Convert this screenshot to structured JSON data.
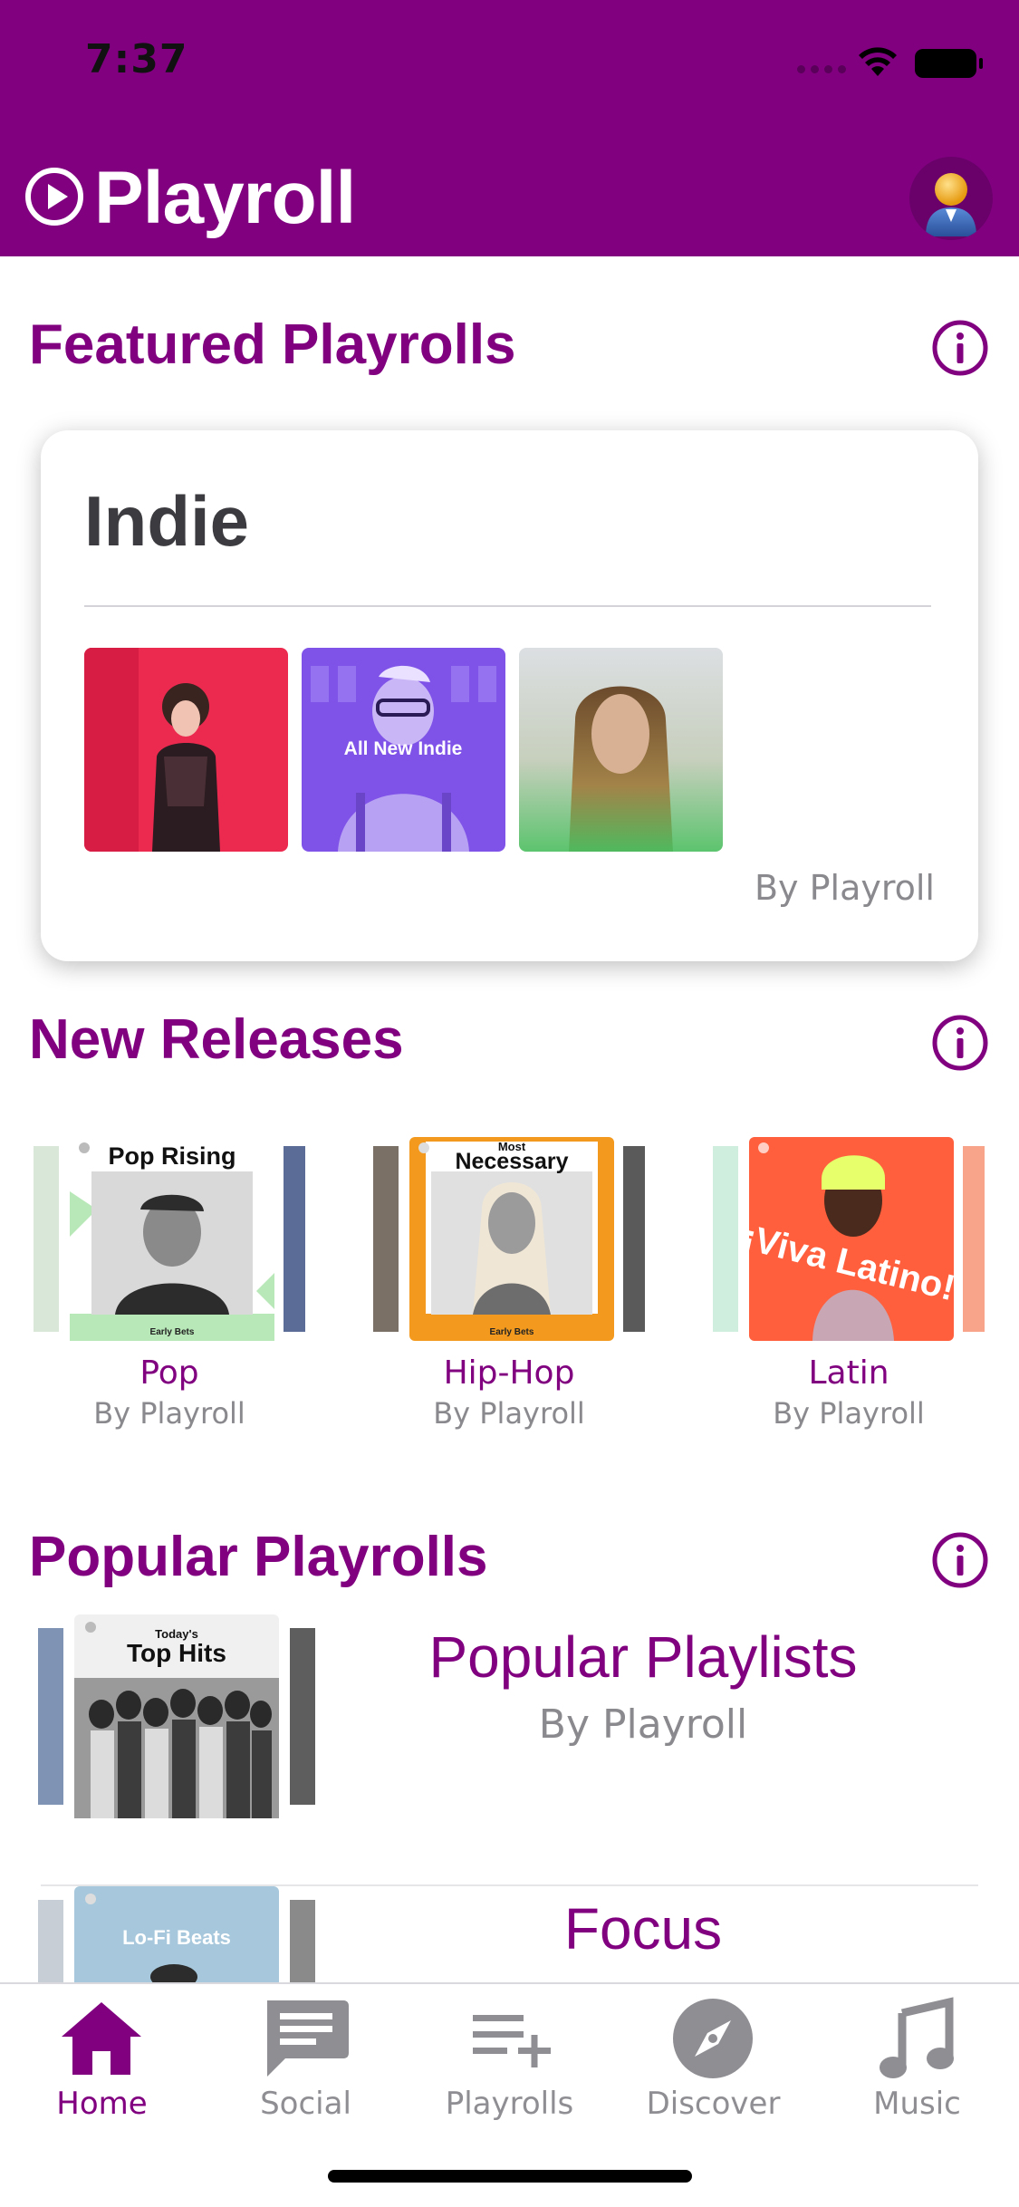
{
  "status_bar": {
    "time": "7:37"
  },
  "app": {
    "title": "Playroll"
  },
  "colors": {
    "brand": "#800080",
    "muted": "#8a8a8e",
    "tab_inactive": "#8e8e93"
  },
  "featured": {
    "section_title": "Featured Playrolls",
    "card": {
      "title": "Indie",
      "thumbnails": [
        {
          "name": "indie-art-1"
        },
        {
          "name": "indie-art-2",
          "overlay_text": "All New Indie"
        },
        {
          "name": "indie-art-3"
        }
      ],
      "by": "By Playroll"
    }
  },
  "new_releases": {
    "section_title": "New Releases",
    "items": [
      {
        "label": "Pop",
        "by": "By Playroll",
        "art_title": "Pop Rising",
        "art_caption": "Early Bets"
      },
      {
        "label": "Hip-Hop",
        "by": "By Playroll",
        "art_title_small": "Most",
        "art_title": "Necessary",
        "art_caption": "Early Bets"
      },
      {
        "label": "Latin",
        "by": "By Playroll",
        "art_title": "¡Viva Latino!"
      }
    ]
  },
  "popular": {
    "section_title": "Popular Playrolls",
    "items": [
      {
        "title": "Popular Playlists",
        "by": "By Playroll",
        "art_title_small": "Today's",
        "art_title": "Top Hits"
      },
      {
        "title": "Focus",
        "art_title": "Lo-Fi Beats"
      }
    ]
  },
  "tabbar": {
    "tabs": [
      {
        "label": "Home",
        "icon": "home-icon",
        "active": true
      },
      {
        "label": "Social",
        "icon": "chat-icon",
        "active": false
      },
      {
        "label": "Playrolls",
        "icon": "playlist-add-icon",
        "active": false
      },
      {
        "label": "Discover",
        "icon": "compass-icon",
        "active": false
      },
      {
        "label": "Music",
        "icon": "music-note-icon",
        "active": false
      }
    ]
  }
}
